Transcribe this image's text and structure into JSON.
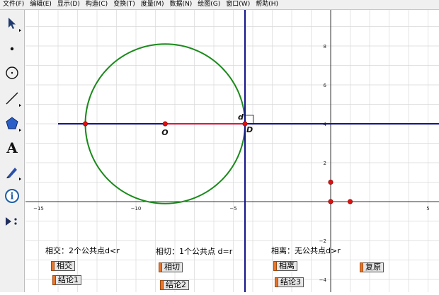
{
  "menu": [
    "文件(F)",
    "编辑(E)",
    "显示(D)",
    "构造(C)",
    "变换(T)",
    "度量(M)",
    "数据(N)",
    "绘图(G)",
    "窗口(W)",
    "帮助(H)"
  ],
  "tools": [
    {
      "name": "arrow-select-tool",
      "icon": "arrow-icon"
    },
    {
      "name": "point-tool",
      "icon": "point-icon"
    },
    {
      "name": "compass-tool",
      "icon": "circle-icon"
    },
    {
      "name": "straightedge-tool",
      "icon": "segment-icon"
    },
    {
      "name": "polygon-tool",
      "icon": "pentagon-icon"
    },
    {
      "name": "text-tool",
      "icon": "letter-a-icon",
      "glyph": "A"
    },
    {
      "name": "marker-tool",
      "icon": "pen-icon"
    },
    {
      "name": "information-tool",
      "icon": "info-icon",
      "glyph": "i"
    },
    {
      "name": "custom-tool",
      "icon": "play-menu-icon"
    }
  ],
  "graph": {
    "x_ticks": [
      "−15",
      "−10",
      "−5",
      "5"
    ],
    "y_ticks": [
      "8",
      "6",
      "4",
      "2",
      "−2",
      "−4"
    ],
    "circle": {
      "center": [
        -8.5,
        4
      ],
      "radius": 4.1,
      "color": "#1a8a1a"
    },
    "horizontal_line_y": 4,
    "vertical_line_x": -4.4,
    "segment": {
      "from": [
        -8.5,
        4
      ],
      "to": [
        -4.4,
        4
      ],
      "color": "#d8183c"
    },
    "line_color": "#14148c",
    "point_color": "#e01010",
    "points": [
      {
        "label": "O",
        "x": -8.5,
        "y": 4
      },
      {
        "label": "D",
        "x": -4.4,
        "y": 4
      },
      {
        "label": "",
        "x": -12.6,
        "y": 4
      },
      {
        "label": "",
        "x": 0,
        "y": 1
      },
      {
        "label": "",
        "x": 0,
        "y": 0
      },
      {
        "label": "",
        "x": 1,
        "y": 0
      }
    ],
    "right_angle_label": "d"
  },
  "cases": {
    "intersect_text": "相交：2个公共点d<r",
    "tangent_text": "相切：1个公共点 d=r",
    "separate_text": "相离：无公共点d>r"
  },
  "buttons": {
    "intersect": "相交",
    "conclusion1": "结论1",
    "tangent": "相切",
    "conclusion2": "结论2",
    "separate": "相离",
    "conclusion3": "结论3",
    "reset": "复原"
  }
}
